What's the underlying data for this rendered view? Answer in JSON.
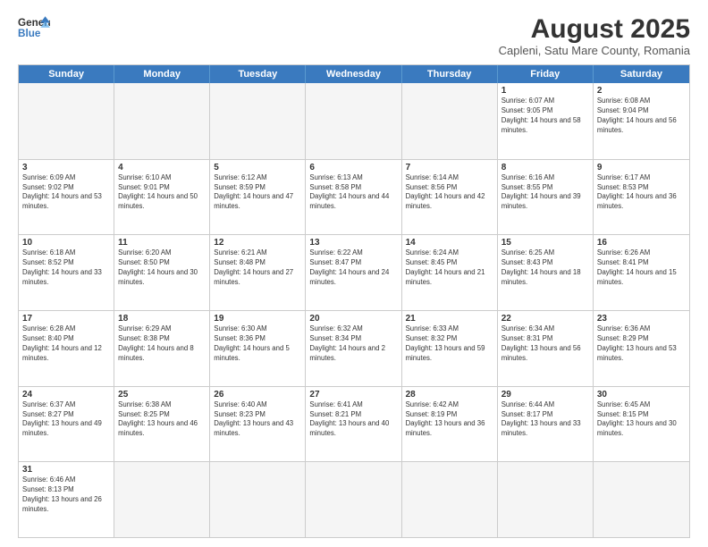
{
  "header": {
    "logo_general": "General",
    "logo_blue": "Blue",
    "month_title": "August 2025",
    "location": "Capleni, Satu Mare County, Romania"
  },
  "weekdays": [
    "Sunday",
    "Monday",
    "Tuesday",
    "Wednesday",
    "Thursday",
    "Friday",
    "Saturday"
  ],
  "weeks": [
    [
      {
        "day": "",
        "info": "",
        "empty": true
      },
      {
        "day": "",
        "info": "",
        "empty": true
      },
      {
        "day": "",
        "info": "",
        "empty": true
      },
      {
        "day": "",
        "info": "",
        "empty": true
      },
      {
        "day": "",
        "info": "",
        "empty": true
      },
      {
        "day": "1",
        "info": "Sunrise: 6:07 AM\nSunset: 9:05 PM\nDaylight: 14 hours and 58 minutes.",
        "empty": false
      },
      {
        "day": "2",
        "info": "Sunrise: 6:08 AM\nSunset: 9:04 PM\nDaylight: 14 hours and 56 minutes.",
        "empty": false
      }
    ],
    [
      {
        "day": "3",
        "info": "Sunrise: 6:09 AM\nSunset: 9:02 PM\nDaylight: 14 hours and 53 minutes.",
        "empty": false
      },
      {
        "day": "4",
        "info": "Sunrise: 6:10 AM\nSunset: 9:01 PM\nDaylight: 14 hours and 50 minutes.",
        "empty": false
      },
      {
        "day": "5",
        "info": "Sunrise: 6:12 AM\nSunset: 8:59 PM\nDaylight: 14 hours and 47 minutes.",
        "empty": false
      },
      {
        "day": "6",
        "info": "Sunrise: 6:13 AM\nSunset: 8:58 PM\nDaylight: 14 hours and 44 minutes.",
        "empty": false
      },
      {
        "day": "7",
        "info": "Sunrise: 6:14 AM\nSunset: 8:56 PM\nDaylight: 14 hours and 42 minutes.",
        "empty": false
      },
      {
        "day": "8",
        "info": "Sunrise: 6:16 AM\nSunset: 8:55 PM\nDaylight: 14 hours and 39 minutes.",
        "empty": false
      },
      {
        "day": "9",
        "info": "Sunrise: 6:17 AM\nSunset: 8:53 PM\nDaylight: 14 hours and 36 minutes.",
        "empty": false
      }
    ],
    [
      {
        "day": "10",
        "info": "Sunrise: 6:18 AM\nSunset: 8:52 PM\nDaylight: 14 hours and 33 minutes.",
        "empty": false
      },
      {
        "day": "11",
        "info": "Sunrise: 6:20 AM\nSunset: 8:50 PM\nDaylight: 14 hours and 30 minutes.",
        "empty": false
      },
      {
        "day": "12",
        "info": "Sunrise: 6:21 AM\nSunset: 8:48 PM\nDaylight: 14 hours and 27 minutes.",
        "empty": false
      },
      {
        "day": "13",
        "info": "Sunrise: 6:22 AM\nSunset: 8:47 PM\nDaylight: 14 hours and 24 minutes.",
        "empty": false
      },
      {
        "day": "14",
        "info": "Sunrise: 6:24 AM\nSunset: 8:45 PM\nDaylight: 14 hours and 21 minutes.",
        "empty": false
      },
      {
        "day": "15",
        "info": "Sunrise: 6:25 AM\nSunset: 8:43 PM\nDaylight: 14 hours and 18 minutes.",
        "empty": false
      },
      {
        "day": "16",
        "info": "Sunrise: 6:26 AM\nSunset: 8:41 PM\nDaylight: 14 hours and 15 minutes.",
        "empty": false
      }
    ],
    [
      {
        "day": "17",
        "info": "Sunrise: 6:28 AM\nSunset: 8:40 PM\nDaylight: 14 hours and 12 minutes.",
        "empty": false
      },
      {
        "day": "18",
        "info": "Sunrise: 6:29 AM\nSunset: 8:38 PM\nDaylight: 14 hours and 8 minutes.",
        "empty": false
      },
      {
        "day": "19",
        "info": "Sunrise: 6:30 AM\nSunset: 8:36 PM\nDaylight: 14 hours and 5 minutes.",
        "empty": false
      },
      {
        "day": "20",
        "info": "Sunrise: 6:32 AM\nSunset: 8:34 PM\nDaylight: 14 hours and 2 minutes.",
        "empty": false
      },
      {
        "day": "21",
        "info": "Sunrise: 6:33 AM\nSunset: 8:32 PM\nDaylight: 13 hours and 59 minutes.",
        "empty": false
      },
      {
        "day": "22",
        "info": "Sunrise: 6:34 AM\nSunset: 8:31 PM\nDaylight: 13 hours and 56 minutes.",
        "empty": false
      },
      {
        "day": "23",
        "info": "Sunrise: 6:36 AM\nSunset: 8:29 PM\nDaylight: 13 hours and 53 minutes.",
        "empty": false
      }
    ],
    [
      {
        "day": "24",
        "info": "Sunrise: 6:37 AM\nSunset: 8:27 PM\nDaylight: 13 hours and 49 minutes.",
        "empty": false
      },
      {
        "day": "25",
        "info": "Sunrise: 6:38 AM\nSunset: 8:25 PM\nDaylight: 13 hours and 46 minutes.",
        "empty": false
      },
      {
        "day": "26",
        "info": "Sunrise: 6:40 AM\nSunset: 8:23 PM\nDaylight: 13 hours and 43 minutes.",
        "empty": false
      },
      {
        "day": "27",
        "info": "Sunrise: 6:41 AM\nSunset: 8:21 PM\nDaylight: 13 hours and 40 minutes.",
        "empty": false
      },
      {
        "day": "28",
        "info": "Sunrise: 6:42 AM\nSunset: 8:19 PM\nDaylight: 13 hours and 36 minutes.",
        "empty": false
      },
      {
        "day": "29",
        "info": "Sunrise: 6:44 AM\nSunset: 8:17 PM\nDaylight: 13 hours and 33 minutes.",
        "empty": false
      },
      {
        "day": "30",
        "info": "Sunrise: 6:45 AM\nSunset: 8:15 PM\nDaylight: 13 hours and 30 minutes.",
        "empty": false
      }
    ],
    [
      {
        "day": "31",
        "info": "Sunrise: 6:46 AM\nSunset: 8:13 PM\nDaylight: 13 hours and 26 minutes.",
        "empty": false
      },
      {
        "day": "",
        "info": "",
        "empty": true
      },
      {
        "day": "",
        "info": "",
        "empty": true
      },
      {
        "day": "",
        "info": "",
        "empty": true
      },
      {
        "day": "",
        "info": "",
        "empty": true
      },
      {
        "day": "",
        "info": "",
        "empty": true
      },
      {
        "day": "",
        "info": "",
        "empty": true
      }
    ]
  ]
}
